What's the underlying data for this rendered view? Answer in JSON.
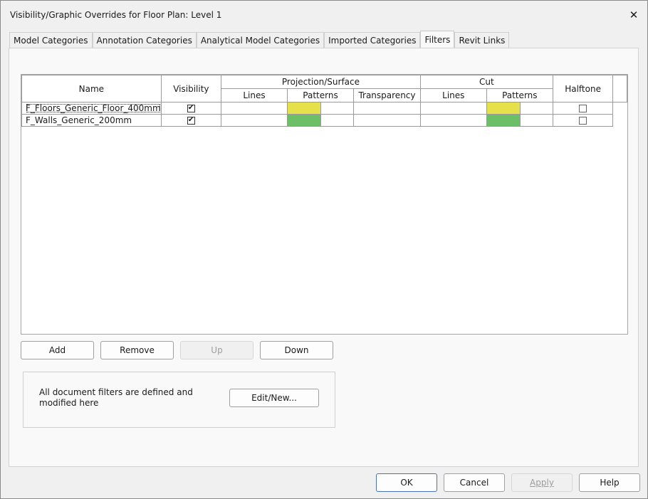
{
  "window": {
    "title": "Visibility/Graphic Overrides for Floor Plan: Level 1",
    "close_glyph": "✕"
  },
  "tabs": [
    {
      "label": "Model Categories",
      "active": false
    },
    {
      "label": "Annotation Categories",
      "active": false
    },
    {
      "label": "Analytical Model Categories",
      "active": false
    },
    {
      "label": "Imported Categories",
      "active": false
    },
    {
      "label": "Filters",
      "active": true
    },
    {
      "label": "Revit Links",
      "active": false
    }
  ],
  "grid": {
    "headers": {
      "name": "Name",
      "visibility": "Visibility",
      "projection_group": "Projection/Surface",
      "cut_group": "Cut",
      "halftone": "Halftone",
      "proj_lines": "Lines",
      "proj_patterns": "Patterns",
      "proj_transparency": "Transparency",
      "cut_lines": "Lines",
      "cut_patterns": "Patterns"
    },
    "rows": [
      {
        "name": "F_Floors_Generic_Floor_400mm",
        "visible": true,
        "proj_pattern_color": "#e6e04a",
        "cut_pattern_color": "#e6e04a",
        "halftone": false
      },
      {
        "name": "F_Walls_Generic_200mm",
        "visible": true,
        "proj_pattern_color": "#6dbf67",
        "cut_pattern_color": "#6dbf67",
        "halftone": false
      }
    ]
  },
  "list_buttons": {
    "add": "Add",
    "remove": "Remove",
    "up": "Up",
    "down": "Down"
  },
  "filter_info": {
    "text_line1": "All document filters are defined and",
    "text_line2": "modified here",
    "edit_new": "Edit/New..."
  },
  "footer": {
    "ok": "OK",
    "cancel": "Cancel",
    "apply": "Apply",
    "help": "Help"
  }
}
